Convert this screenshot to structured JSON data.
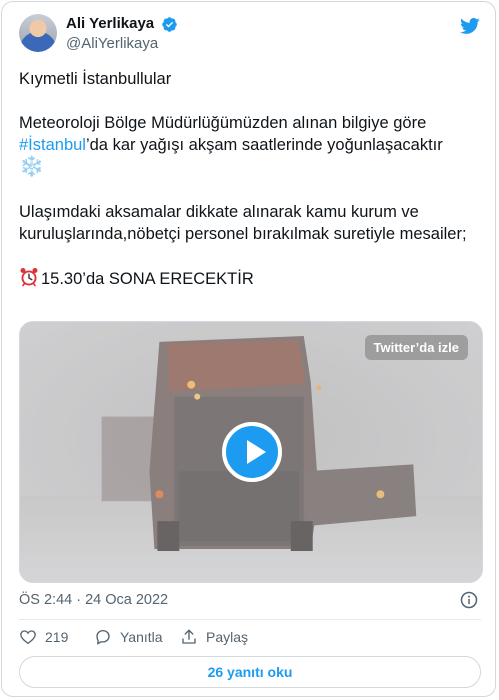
{
  "author": {
    "display_name": "Ali Yerlikaya",
    "handle": "@AliYerlikaya",
    "verified": true
  },
  "tweet": {
    "greeting": "Kıymetli İstanbullular",
    "line2_before": "Meteoroloji Bölge Müdürlüğümüzden alınan bilgiye göre",
    "hashtag": "#İstanbul",
    "line2_after": "’da kar yağışı akşam saatlerinde yoğunlaşacaktır",
    "snow_emoji": "❄️",
    "paragraph3": "Ulaşımdaki aksamalar dikkate alınarak kamu kurum ve kuruluşlarında,nöbetçi personel bırakılmak suretiyle mesailer;",
    "closing": "15.30’da SONA ERECEKTİR"
  },
  "media": {
    "watch_label": "Twitter’da izle"
  },
  "meta": {
    "timestamp": "ÖS 2:44 · 24 Oca 2022"
  },
  "actions": {
    "likes": "219",
    "reply_label": "Yanıtla",
    "share_label": "Paylaş"
  },
  "replies_button": "26 yanıtı oku",
  "colors": {
    "accent": "#1d9bf0",
    "like_icon": "#536471"
  },
  "icons": [
    "avatar",
    "verified-badge-icon",
    "twitter-bird-icon",
    "alarm-clock-icon",
    "play-icon",
    "info-icon",
    "heart-icon",
    "reply-icon",
    "share-icon"
  ]
}
